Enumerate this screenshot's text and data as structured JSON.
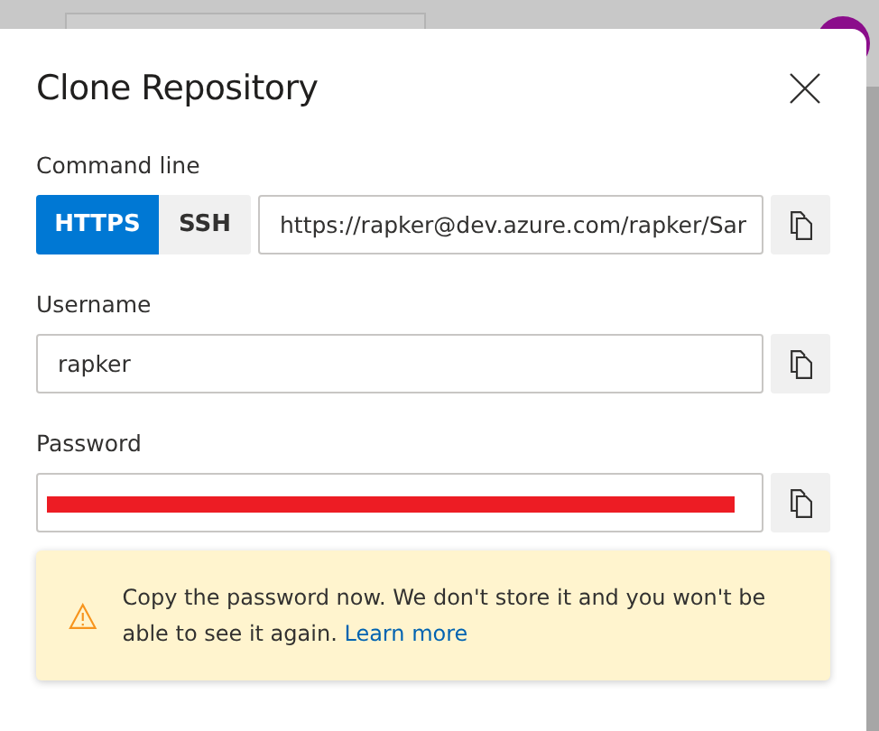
{
  "dialog": {
    "title": "Clone Repository",
    "command_line": {
      "label": "Command line",
      "protocols": [
        {
          "label": "HTTPS",
          "selected": true
        },
        {
          "label": "SSH",
          "selected": false
        }
      ],
      "url": "https://rapker@dev.azure.com/rapker/Sar"
    },
    "username": {
      "label": "Username",
      "value": "rapker"
    },
    "password": {
      "label": "Password",
      "redacted": true
    },
    "warning": {
      "text": "Copy the password now. We don't store it and you won't be able to see it again.",
      "link": "Learn more"
    }
  }
}
